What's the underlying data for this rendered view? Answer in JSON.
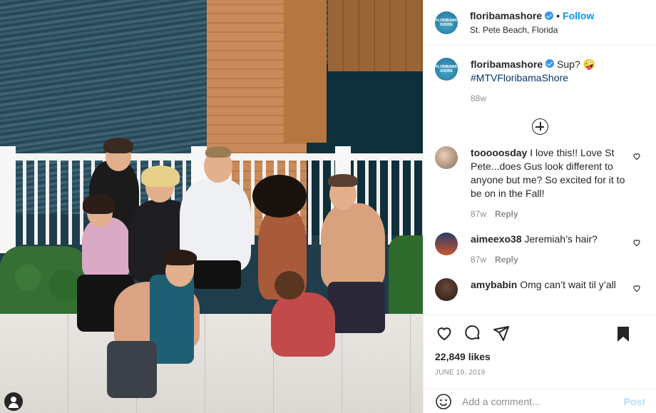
{
  "header": {
    "username": "floribamashore",
    "follow_label": "Follow",
    "location": "St. Pete Beach, Florida",
    "more_label": "•••"
  },
  "caption": {
    "username": "floribamashore",
    "text": "Sup? 🤪",
    "hashtag": "#MTVFloribamaShore",
    "age": "88w"
  },
  "comments": [
    {
      "username": "tooooosday",
      "text": "I love this!! Love St Pete...does Gus look different to anyone but me? So excited for it to be on in the Fall!",
      "age": "87w",
      "reply_label": "Reply"
    },
    {
      "username": "aimeexo38",
      "text": "Jeremiah’s hair?",
      "age": "87w",
      "reply_label": "Reply"
    },
    {
      "username": "amybabin",
      "text": "Omg can’t wait til y’all",
      "age": "",
      "reply_label": ""
    }
  ],
  "post": {
    "likes": "22,849 likes",
    "date": "JUNE 19, 2019"
  },
  "add_comment": {
    "placeholder": "Add a comment...",
    "post_label": "Post"
  },
  "logo_text": "FLORIBAMA SHORE",
  "colors": {
    "accent": "#0095f6",
    "verified": "#3897f0",
    "muted": "#8e8e8e"
  },
  "icons": [
    "heart-icon",
    "comment-icon",
    "share-icon",
    "bookmark-icon",
    "emoji-icon",
    "add-comment-icon",
    "user-icon"
  ]
}
